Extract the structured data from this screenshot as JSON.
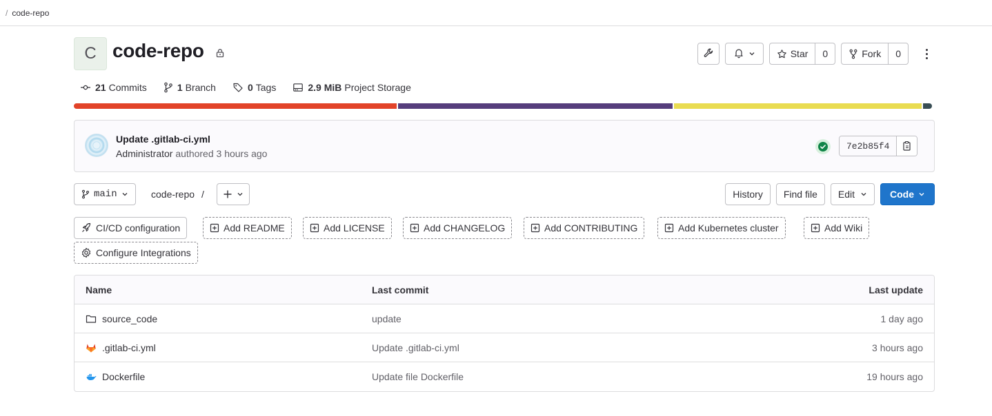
{
  "breadcrumb": {
    "separator": "/",
    "current": "code-repo"
  },
  "project": {
    "avatar_letter": "C",
    "name": "code-repo",
    "actions": {
      "star_label": "Star",
      "star_count": "0",
      "fork_label": "Fork",
      "fork_count": "0"
    }
  },
  "stats": {
    "commits_count": "21",
    "commits_label": "Commits",
    "branches_count": "1",
    "branches_label": "Branch",
    "tags_count": "0",
    "tags_label": "Tags",
    "storage_size": "2.9 MiB",
    "storage_label": "Project Storage"
  },
  "language_bar": [
    {
      "color": "#e24329",
      "fraction": 0.377
    },
    {
      "color": "#563d7c",
      "fraction": 0.32
    },
    {
      "color": "#e9dc51",
      "fraction": 0.289
    },
    {
      "color": "#384d54",
      "fraction": 0.011
    }
  ],
  "last_commit": {
    "title": "Update .gitlab-ci.yml",
    "author": "Administrator",
    "authored_text": "authored 3 hours ago",
    "sha": "7e2b85f4",
    "pipeline_status": "success"
  },
  "tree": {
    "branch": "main",
    "path": "code-repo",
    "path_sep": "/",
    "history_label": "History",
    "find_file_label": "Find file",
    "edit_label": "Edit",
    "code_label": "Code"
  },
  "shortcuts": {
    "cicd": "CI/CD configuration",
    "readme": "Add README",
    "license": "Add LICENSE",
    "changelog": "Add CHANGELOG",
    "contributing": "Add CONTRIBUTING",
    "kubernetes": "Add Kubernetes cluster",
    "wiki": "Add Wiki",
    "integrations": "Configure Integrations"
  },
  "files": {
    "headers": {
      "name": "Name",
      "last_commit": "Last commit",
      "last_update": "Last update"
    },
    "rows": [
      {
        "name": "source_code",
        "icon": "folder-icon",
        "commit": "update",
        "updated": "1 day ago"
      },
      {
        "name": ".gitlab-ci.yml",
        "icon": "gitlab-icon",
        "commit": "Update .gitlab-ci.yml",
        "updated": "3 hours ago"
      },
      {
        "name": "Dockerfile",
        "icon": "docker-icon",
        "commit": "Update file Dockerfile",
        "updated": "19 hours ago"
      }
    ]
  }
}
